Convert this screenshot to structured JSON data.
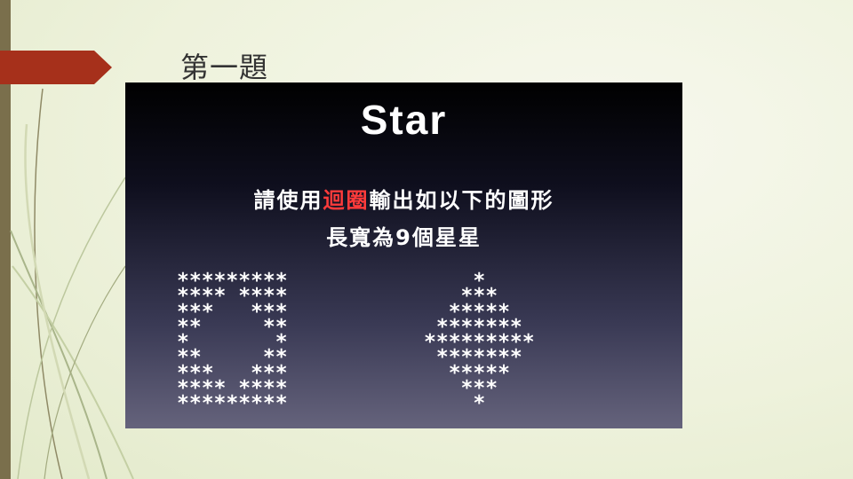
{
  "slide": {
    "title": "第一題"
  },
  "panel": {
    "heading": "Star",
    "instruction_line1_pre": "請使用",
    "instruction_line1_highlight": "迴圈",
    "instruction_line1_post": "輸出如以下的圖形",
    "instruction_line2": "長寬為9個星星",
    "left_pattern": "*********\n**** ****\n***   ***\n**     **\n*       *\n**     **\n***   ***\n**** ****\n*********",
    "right_pattern": "    *\n   ***\n  *****\n *******\n*********\n *******\n  *****\n   ***\n    *"
  },
  "colors": {
    "accent_arrow": "#a6301b",
    "highlight_text": "#ff3b3b",
    "sidebar": "#7a6f4c"
  }
}
